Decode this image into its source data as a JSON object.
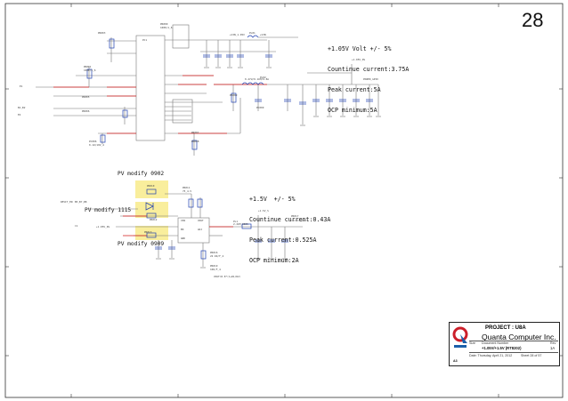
{
  "page": {
    "number": "28"
  },
  "notes": {
    "rail_1v05": [
      "+1.05V Volt +/- 5%",
      "Countinue current:3.75A",
      "Peak current:5A",
      "OCP minimum:5A"
    ],
    "rail_1v5": [
      "+1.5V  +/- 5%",
      "Countinue current:0.43A",
      "Peak current:0.525A",
      "OCP minimum:2A"
    ]
  },
  "pv_notes": {
    "top": "PV modify 0902",
    "middle": "PV modify 1115",
    "bottom": "PV modify 0909"
  },
  "title_block": {
    "project": "PROJECT : U8A",
    "company": "Quanta Computer Inc.",
    "size_label": "Size",
    "doc_label": "Document Number",
    "rev_label": "Rev",
    "document": "+1.05V/+1.5V (RT8202)",
    "rev": "1A",
    "date": "Date:  Thursday, April 21, 2012",
    "sheet": "Sheet  28   of  57",
    "size": "A3"
  },
  "small_labels": {
    "net_vin": "+VIN",
    "net_3v": "+3V",
    "net_5v": "+5V",
    "net_1v05": "+1.05V_S",
    "net_1v5": "+1.5V",
    "net_pg": "+1.05V_PG",
    "ic_1": "RT8202PQW",
    "ic_2": "RT9025-25PSP",
    "tag_p": "P",
    "tag_d1": "D1"
  },
  "colors": {
    "wire": "#777777",
    "net_red": "#d11a1a",
    "component_blue": "#1f3fb0",
    "highlight": "#f4e04a",
    "logo_red": "#cc1f2a",
    "logo_blue": "#1b5faa"
  }
}
